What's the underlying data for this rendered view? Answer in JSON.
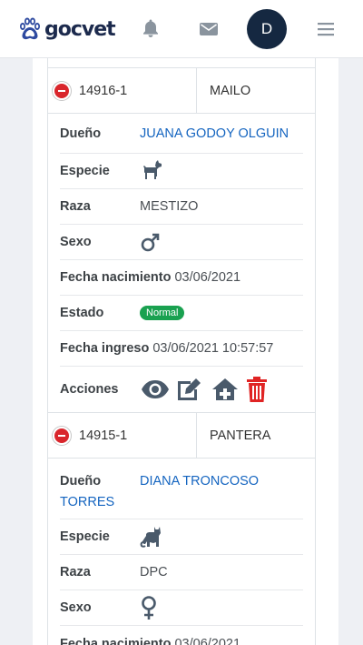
{
  "brand": {
    "name": "gocvet"
  },
  "header": {
    "avatar_initial": "D",
    "icons": [
      "bell-icon",
      "envelope-icon",
      "menu-icon"
    ]
  },
  "records": [
    {
      "code": "14916-1",
      "name": "MAILO",
      "owner_label": "Dueño",
      "owner": "JUANA GODOY OLGUIN",
      "species_label": "Especie",
      "species_icon": "dog-icon",
      "breed_label": "Raza",
      "breed": "MESTIZO",
      "sex_label": "Sexo",
      "sex_icon": "male-icon",
      "birth_label": "Fecha nacimiento",
      "birth": "03/06/2021",
      "status_label": "Estado",
      "status": "Normal",
      "entry_label": "Fecha ingreso",
      "entry": "03/06/2021 10:57:57",
      "actions_label": "Acciones",
      "actions": [
        "view-eye-icon",
        "edit-icon",
        "hospitalize-house-icon",
        "delete-trash-icon"
      ]
    },
    {
      "code": "14915-1",
      "name": "PANTERA",
      "owner_label": "Dueño",
      "owner": "DIANA TRONCOSO TORRES",
      "owner_line1": "DIANA TRONCOSO",
      "owner_line2": "TORRES",
      "species_label": "Especie",
      "species_icon": "cat-icon",
      "breed_label": "Raza",
      "breed": "DPC",
      "sex_label": "Sexo",
      "sex_icon": "female-icon",
      "birth_label": "Fecha nacimiento",
      "birth": "03/06/2021"
    }
  ],
  "colors": {
    "navy": "#152841",
    "link": "#1565c0",
    "danger": "#e02424",
    "success": "#1aa150",
    "icon": "#4a5a6b"
  }
}
